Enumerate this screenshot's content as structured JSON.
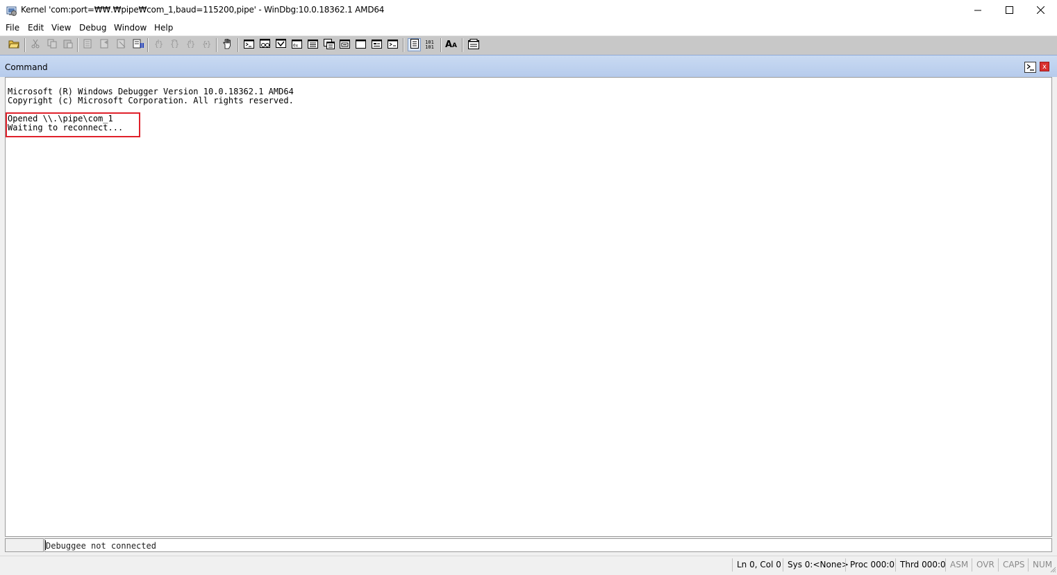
{
  "window": {
    "title": "Kernel 'com:port=₩₩.₩pipe₩com_1,baud=115200,pipe' - WinDbg:10.0.18362.1 AMD64",
    "minimize_glyph": "—",
    "maximize_glyph": "☐",
    "close_glyph": "✕"
  },
  "menu": {
    "items": [
      "File",
      "Edit",
      "View",
      "Debug",
      "Window",
      "Help"
    ]
  },
  "toolbar": {
    "buttons": [
      {
        "icon": "open-folder-icon",
        "enabled": true
      },
      {
        "icon": "cut-icon",
        "enabled": false
      },
      {
        "icon": "copy-icon",
        "enabled": false
      },
      {
        "icon": "paste-icon",
        "enabled": false
      },
      {
        "icon": "go-icon",
        "enabled": false
      },
      {
        "icon": "restart-icon",
        "enabled": false
      },
      {
        "icon": "stop-debugging-icon",
        "enabled": false
      },
      {
        "icon": "break-icon",
        "enabled": true
      },
      {
        "icon": "step-into-icon",
        "enabled": false
      },
      {
        "icon": "step-over-icon",
        "enabled": false
      },
      {
        "icon": "step-out-icon",
        "enabled": false
      },
      {
        "icon": "run-to-cursor-icon",
        "enabled": false
      },
      {
        "icon": "insert-breakpoint-icon",
        "enabled": true
      },
      {
        "icon": "command-window-icon",
        "enabled": true
      },
      {
        "icon": "watch-window-icon",
        "enabled": true
      },
      {
        "icon": "locals-window-icon",
        "enabled": true
      },
      {
        "icon": "registers-window-icon",
        "enabled": true
      },
      {
        "icon": "memory-window-icon",
        "enabled": true
      },
      {
        "icon": "call-stack-window-icon",
        "enabled": true
      },
      {
        "icon": "disassembly-window-icon",
        "enabled": true
      },
      {
        "icon": "scratch-pad-icon",
        "enabled": true
      },
      {
        "icon": "processes-threads-icon",
        "enabled": true
      },
      {
        "icon": "source-mode-icon",
        "enabled": true
      },
      {
        "icon": "hex-display-icon",
        "enabled": true
      },
      {
        "icon": "font-icon",
        "enabled": true
      },
      {
        "icon": "options-icon",
        "enabled": true
      }
    ],
    "hex_label_top": "101",
    "hex_label_bottom": "101",
    "font_label": "A"
  },
  "command_window": {
    "title": "Command",
    "close_glyph": "x",
    "output_lines": [
      "Microsoft (R) Windows Debugger Version 10.0.18362.1 AMD64",
      "Copyright (c) Microsoft Corporation. All rights reserved.",
      "",
      "Opened \\\\.\\pipe\\com_1",
      "Waiting to reconnect..."
    ],
    "prompt": "",
    "input_value": "Debuggee not connected"
  },
  "statusbar": {
    "position": "Ln 0, Col 0",
    "sys": "Sys 0:<None>",
    "proc": "Proc 000:0",
    "thrd": "Thrd 000:0",
    "asm": "ASM",
    "ovr": "OVR",
    "caps": "CAPS",
    "num": "NUM"
  },
  "colors": {
    "header_gradient_top": "#c9daf2",
    "header_gradient_bottom": "#b6cbec",
    "highlight_border": "#e0202a",
    "toolbar_bg": "#c8c8c8"
  }
}
